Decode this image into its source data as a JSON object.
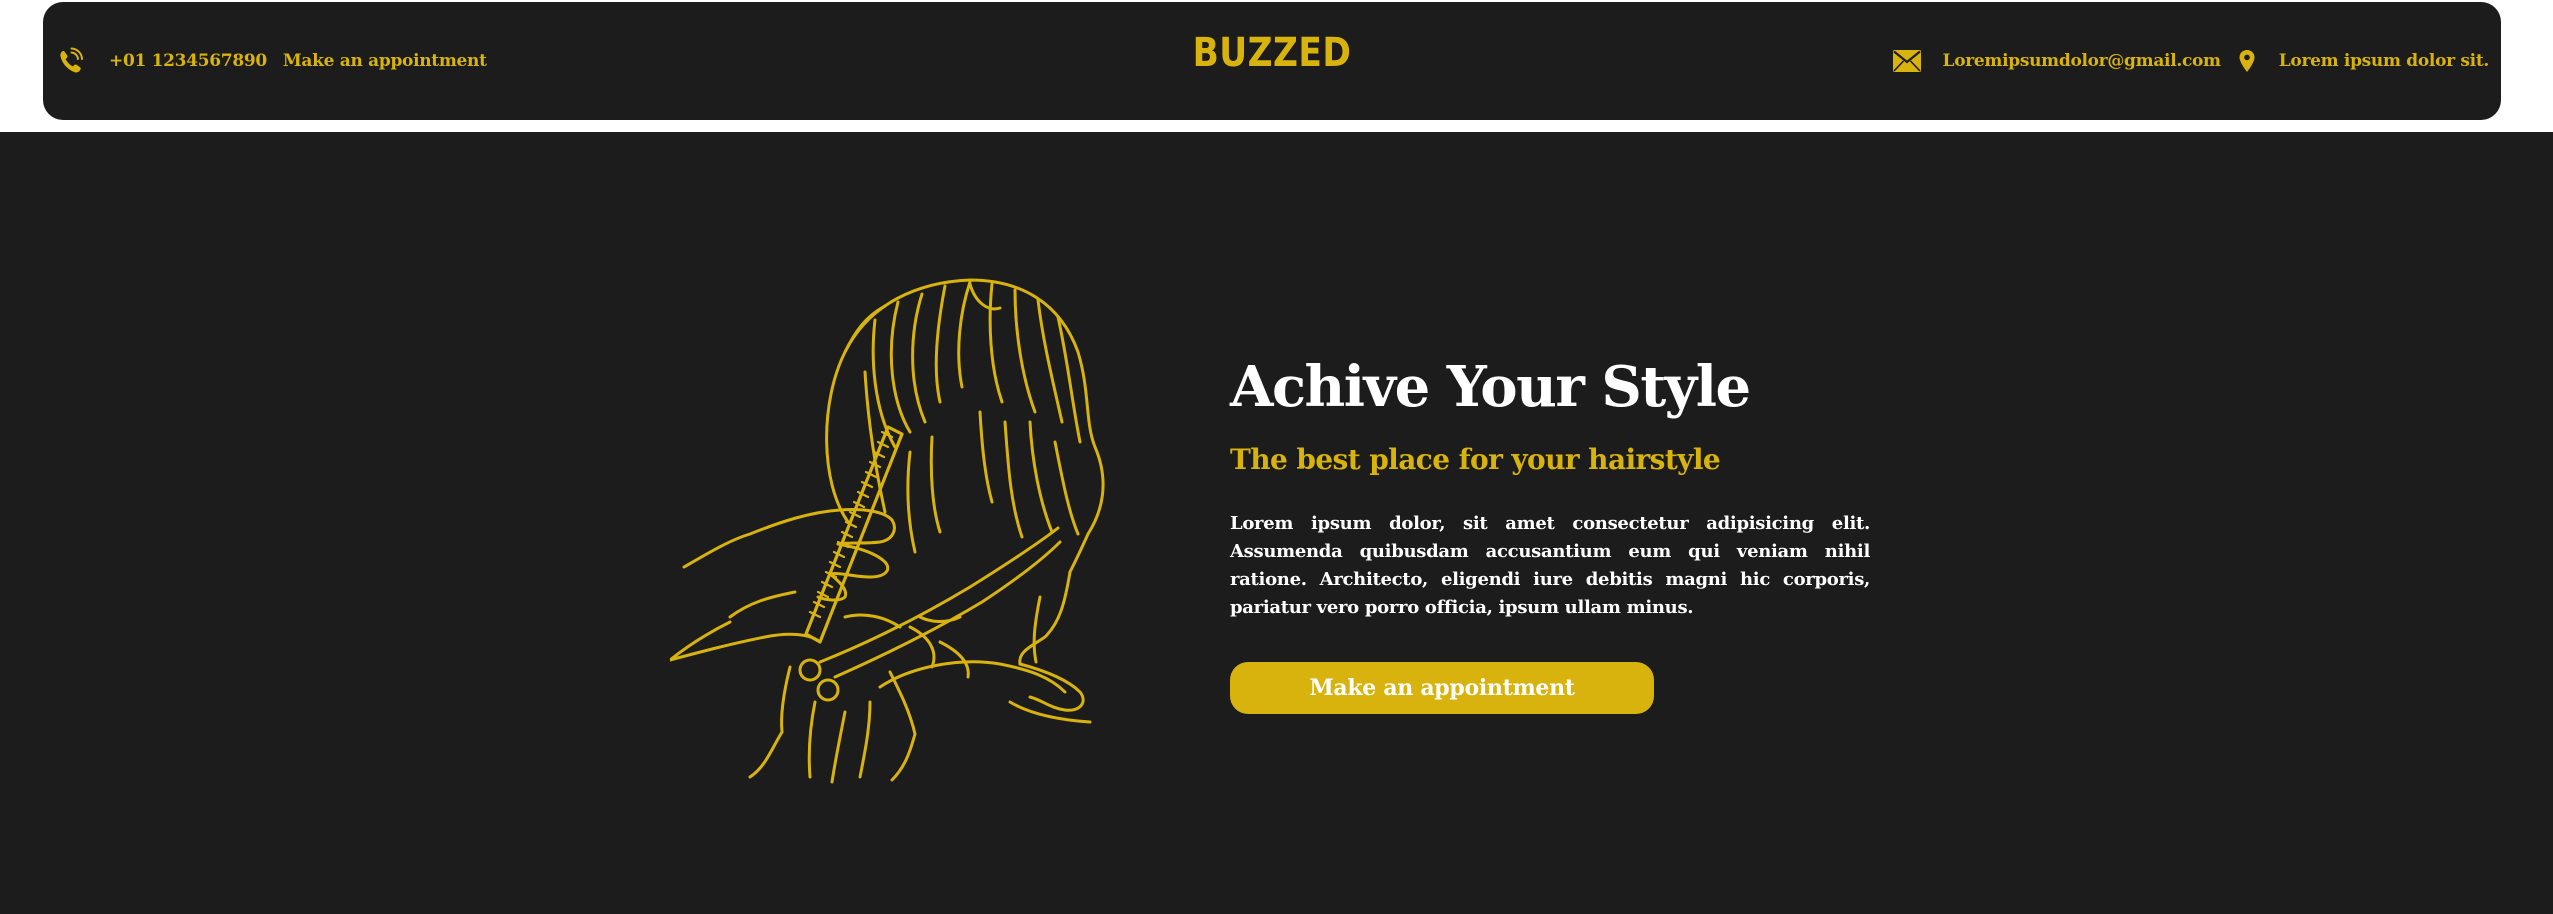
{
  "header": {
    "phone": "+01 1234567890",
    "appointment_link": "Make an appointment",
    "logo": "BUZZED",
    "email": "Loremipsumdolor@gmail.com",
    "address": "Lorem ipsum dolor sit."
  },
  "hero": {
    "title": "Achive Your Style",
    "subtitle": "The best place for your hairstyle",
    "description": "Lorem ipsum dolor, sit amet consectetur adipisicing elit. Assumenda quibusdam accusantium eum qui veniam nihil ratione. Architecto, eligendi iure debitis magni hic corporis, pariatur vero porro officia, ipsum ullam minus.",
    "cta_label": "Make an appointment"
  },
  "icons": {
    "phone": "phone-icon",
    "email": "envelope-icon",
    "location": "map-pin-icon",
    "illustration": "barber-haircut-illustration"
  },
  "colors": {
    "accent": "#d8b30e",
    "background": "#1c1c1c",
    "text": "#ffffff"
  }
}
